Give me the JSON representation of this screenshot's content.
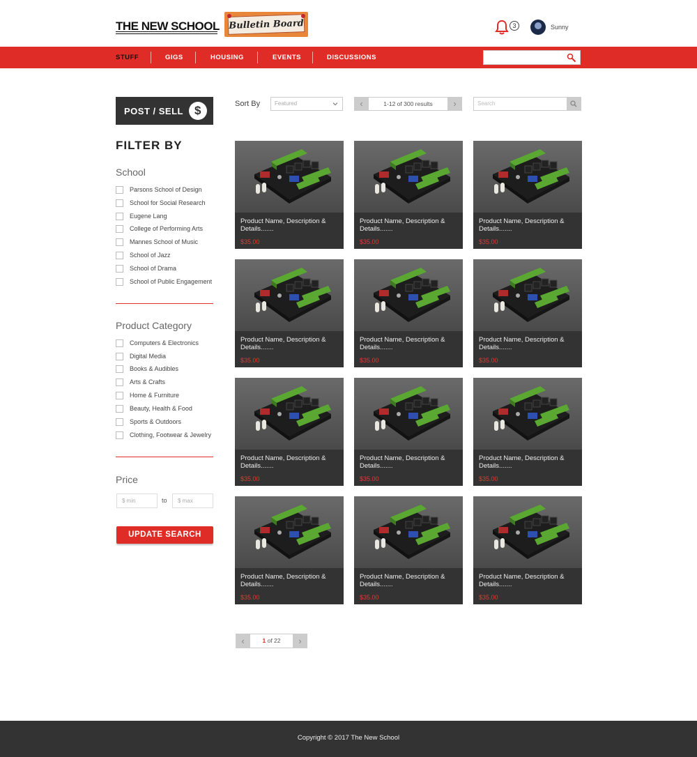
{
  "header": {
    "logo_text": "THE NEW SCHOOL",
    "bulletin_board": "Bulletin Board",
    "notification_count": "3",
    "username": "Sunny"
  },
  "nav": {
    "items": [
      "STUFF",
      "GIGS",
      "HOUSING",
      "EVENTS",
      "DISCUSSIONS"
    ],
    "active": "STUFF"
  },
  "sidebar": {
    "post_button": "POST / SELL",
    "dollar_symbol": "$",
    "filter_title": "FILTER BY",
    "school_title": "School",
    "schools": [
      "Parsons School of Design",
      "School for Social Research",
      "Eugene Lang",
      "College of Performing Arts",
      "Mannes School of Music",
      "School of Jazz",
      "School of Drama",
      "School of Public Engagement"
    ],
    "category_title": "Product Category",
    "categories": [
      "Computers & Electronics",
      "Digital Media",
      "Books & Audibles",
      "Arts & Crafts",
      "Home & Furniture",
      "Beauty, Health & Food",
      "Sports & Outdoors",
      "Clothing, Footwear & Jewelry"
    ],
    "price_title": "Price",
    "price_min_placeholder": "$ min",
    "price_to": "to",
    "price_max_placeholder": "$ max",
    "update_button": "UPDATE SEARCH"
  },
  "toolbar": {
    "sort_label": "Sort By",
    "sort_value": "Featured",
    "results_text": "1-12 of 300 results",
    "search_placeholder": "Search"
  },
  "products": [
    {
      "name": "Product Name, Description & Details.......",
      "price": "$35.00"
    },
    {
      "name": "Product Name, Description & Details.......",
      "price": "$35.00"
    },
    {
      "name": "Product Name, Description & Details.......",
      "price": "$35.00"
    },
    {
      "name": "Product Name, Description & Details.......",
      "price": "$35.00"
    },
    {
      "name": "Product Name, Description & Details.......",
      "price": "$35.00"
    },
    {
      "name": "Product Name, Description & Details.......",
      "price": "$35.00"
    },
    {
      "name": "Product Name, Description & Details.......",
      "price": "$35.00"
    },
    {
      "name": "Product Name, Description & Details.......",
      "price": "$35.00"
    },
    {
      "name": "Product Name, Description & Details.......",
      "price": "$35.00"
    },
    {
      "name": "Product Name, Description & Details.......",
      "price": "$35.00"
    },
    {
      "name": "Product Name, Description & Details.......",
      "price": "$35.00"
    },
    {
      "name": "Product Name, Description & Details.......",
      "price": "$35.00"
    }
  ],
  "pagination": {
    "current_page": "1",
    "of_text": "of 22"
  },
  "footer": {
    "copyright": "Copyright © 2017 The New School"
  },
  "colors": {
    "brand_red": "#e02c26",
    "dark": "#333333"
  },
  "icons": {
    "bell": "bell-icon",
    "search": "search-icon",
    "chevron": "chevron-down-icon",
    "arrows": [
      "chevron-left-icon",
      "chevron-right-icon"
    ]
  }
}
